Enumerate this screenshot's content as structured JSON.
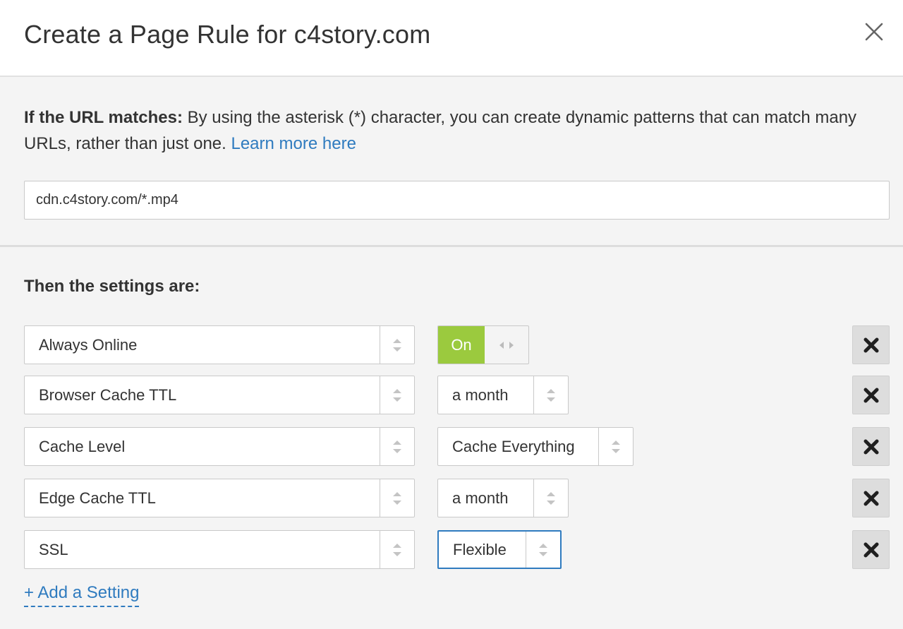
{
  "header": {
    "title": "Create a Page Rule for c4story.com",
    "close_icon": "close-icon"
  },
  "url_section": {
    "label_bold": "If the URL matches:",
    "description": " By using the asterisk (*) character, you can create dynamic patterns that can match many URLs, rather than just one. ",
    "learn_more": "Learn more here",
    "url_value": "cdn.c4story.com/*.mp4"
  },
  "settings": {
    "title": "Then the settings are:",
    "rows": [
      {
        "setting": "Always Online",
        "value_type": "toggle",
        "value": "On"
      },
      {
        "setting": "Browser Cache TTL",
        "value_type": "select",
        "value": "a month"
      },
      {
        "setting": "Cache Level",
        "value_type": "select",
        "value": "Cache Everything"
      },
      {
        "setting": "Edge Cache TTL",
        "value_type": "select",
        "value": "a month"
      },
      {
        "setting": "SSL",
        "value_type": "select",
        "value": "Flexible",
        "focused": true
      }
    ],
    "add_label": "+ Add a Setting"
  },
  "colors": {
    "link": "#2f7bbf",
    "toggle_on": "#9bca3e",
    "focus_border": "#2f7bbf"
  },
  "icons": {
    "select_arrows": "sort-arrows-icon",
    "toggle_handle": "drag-handle-icon",
    "remove": "remove-x-icon"
  }
}
